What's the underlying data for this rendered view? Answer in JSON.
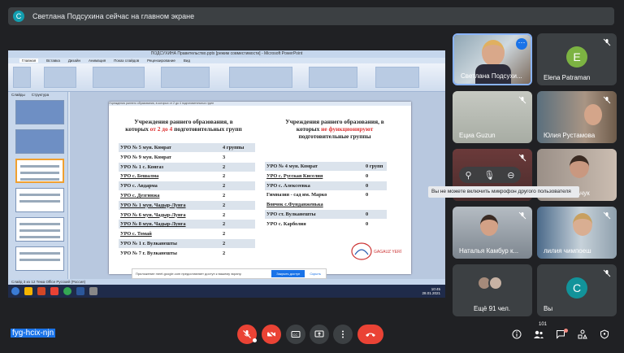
{
  "banner": {
    "avatar_letter": "С",
    "text": "Светлана Подсухина сейчас на главном экране"
  },
  "powerpoint": {
    "window_title": "ПОДСУХИНА Правительство.pptx [режим совместимости] - Microsoft PowerPoint",
    "tabs": [
      "Главная",
      "Вставка",
      "Дизайн",
      "Анимация",
      "Показ слайдов",
      "Рецензирование",
      "Вид"
    ],
    "active_tab": 0,
    "left_tabs": [
      "Слайды",
      "Структура"
    ],
    "status": "Слайд 3 из 12     Тема Office     Русский (Россия)",
    "clock": {
      "time": "10:45",
      "date": "28.01.2021"
    }
  },
  "slide": {
    "strip": "Учреждения раннего образования, в которых от 2 до 4 подготовительных групп",
    "left_head_1": "Учреждения раннего образования, в",
    "left_head_2a": "которых ",
    "left_head_2b": "от 2 до 4",
    "left_head_2c": " подготовительных групп",
    "right_head_1": "Учреждения раннего образования, в",
    "right_head_2a": "которых ",
    "right_head_2b": "не функционируют",
    "right_head_3": "подготовительные группы",
    "left_table": [
      {
        "name": "УРО № 5 мун. Комрат",
        "value": "4 группы"
      },
      {
        "name": "УРО № 9 мун. Комрат",
        "value": "3"
      },
      {
        "name": "УРО № 1 с. Конгаз",
        "value": "2"
      },
      {
        "name": "УРО с. Бешалма",
        "value": "2"
      },
      {
        "name": "УРО с. Авдарма",
        "value": "2"
      },
      {
        "name": "УРО с. Дезгинжа",
        "value": "2"
      },
      {
        "name": "УРО № 1 мун. Чадыр-Лунга",
        "value": "2"
      },
      {
        "name": "УРО № 6 мун. Чадыр-Лунга",
        "value": "2"
      },
      {
        "name": "УРО № 8 мун. Чадыр-Лунга",
        "value": "2"
      },
      {
        "name": "УРО с. Томай",
        "value": "2"
      },
      {
        "name": "УРО № 1 г. Вулканешты",
        "value": "2"
      },
      {
        "name": "УРО № 7 г. Вулканешты",
        "value": "2"
      }
    ],
    "right_table": [
      {
        "name": "УРО № 4 мун. Комрат",
        "value": "0 групп"
      },
      {
        "name": "УРО с. Русская Киселия",
        "value": "0"
      },
      {
        "name": "УРО с. Алексеевка",
        "value": "0"
      },
      {
        "name": "Гимназия - сад им. Марко",
        "value": "0"
      },
      {
        "name": "Вовчок с.Фунданженька",
        "value": ""
      },
      {
        "name": "УРО ст. Вулканешты",
        "value": "0"
      },
      {
        "name": "УРО с. Карболия",
        "value": "0"
      }
    ],
    "logo_text": "GAGAUZ YERİ"
  },
  "notification": {
    "text": "Приложение meet.google.com предоставляет доступ к вашему экрану.",
    "primary": "Закрыть доступ",
    "secondary": "Скрыть"
  },
  "participants": {
    "t1": "Светлана Подсухи...",
    "t2_letter": "E",
    "t2": "Elena Patraman",
    "t3": "Ециа Guzun",
    "t4": "Юлия Рустамова",
    "t6": "...са Михальчук",
    "t7": "Наталья Камбур к...",
    "t8": "лилия чимпоеш",
    "t9": "Ещё 91 чел.",
    "t10_letter": "С",
    "t10": "Вы"
  },
  "tooltip": "Вы не можете включить микрофон другого пользователя",
  "meeting_code": "fyg-hcix-njn",
  "people_count": "101",
  "colors": {
    "accent": "#1a73e8",
    "danger": "#ea4335",
    "bg": "#202124",
    "tile": "#3c4043"
  }
}
